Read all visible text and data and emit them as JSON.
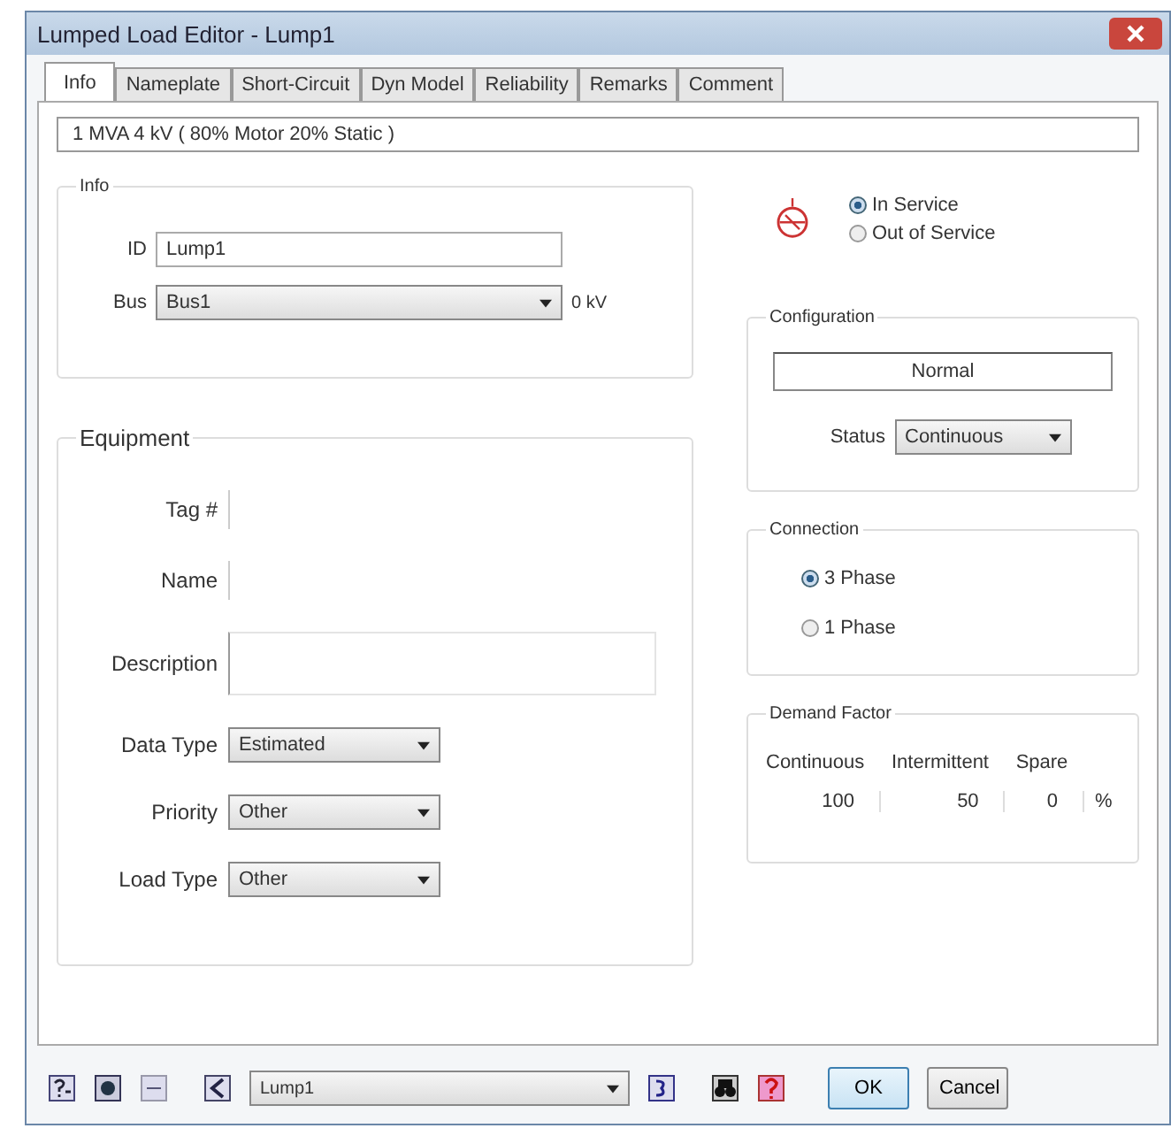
{
  "window": {
    "title": "Lumped Load Editor - Lump1"
  },
  "tabs": [
    {
      "label": "Info",
      "selected": true
    },
    {
      "label": "Nameplate",
      "selected": false
    },
    {
      "label": "Short-Circuit",
      "selected": false
    },
    {
      "label": "Dyn Model",
      "selected": false
    },
    {
      "label": "Reliability",
      "selected": false
    },
    {
      "label": "Remarks",
      "selected": false
    },
    {
      "label": "Comment",
      "selected": false
    }
  ],
  "summary": "1 MVA  4 kV  ( 80% Motor  20% Static )",
  "info": {
    "title": "Info",
    "id_label": "ID",
    "id_value": "Lump1",
    "bus_label": "Bus",
    "bus_value": "Bus1",
    "kv": "0 kV"
  },
  "service": [
    {
      "label": "In Service",
      "selected": true
    },
    {
      "label": "Out of Service",
      "selected": false
    }
  ],
  "configuration": {
    "title": "Configuration",
    "value": "Normal",
    "status_label": "Status",
    "status_value": "Continuous"
  },
  "connection": {
    "title": "Connection",
    "options": [
      {
        "label": "3 Phase",
        "selected": true
      },
      {
        "label": "1 Phase",
        "selected": false
      }
    ]
  },
  "equipment": {
    "title": "Equipment",
    "fields": [
      {
        "label": "Tag #",
        "kind": "text"
      },
      {
        "label": "Name",
        "kind": "text"
      },
      {
        "label": "Description",
        "kind": "textarea"
      },
      {
        "label": "Data Type",
        "kind": "select",
        "value": "Estimated"
      },
      {
        "label": "Priority",
        "kind": "select",
        "value": "Other"
      },
      {
        "label": "Load Type",
        "kind": "select",
        "value": "Other"
      }
    ]
  },
  "demand_factor": {
    "title": "Demand Factor",
    "columns": [
      {
        "label": "Continuous",
        "value": "100"
      },
      {
        "label": "Intermittent",
        "value": "50"
      },
      {
        "label": "Spare",
        "value": "0"
      }
    ],
    "unit": "%"
  },
  "footer": {
    "dropdown": "Lump1",
    "ok": "OK",
    "cancel": "Cancel"
  }
}
